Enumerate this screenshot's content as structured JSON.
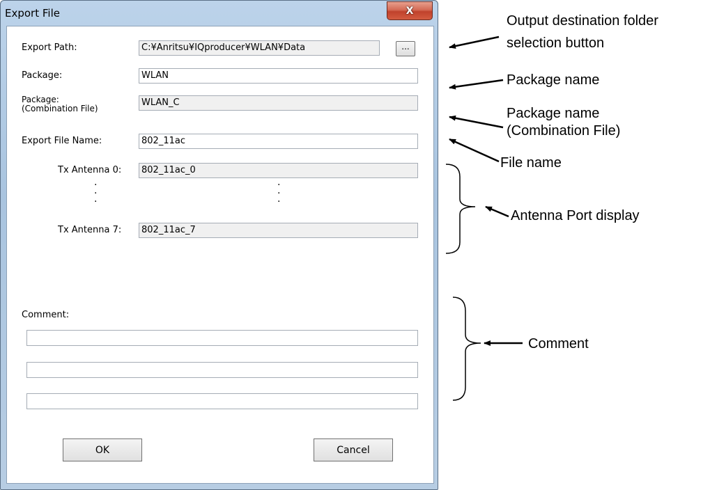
{
  "window": {
    "title": "Export File",
    "close_glyph": "X"
  },
  "form": {
    "export_path_label": "Export Path:",
    "export_path_value": "C:¥Anritsu¥IQproducer¥WLAN¥Data",
    "browse_label": "...",
    "package_label": "Package:",
    "package_value": "WLAN",
    "combo_label_line1": "Package:",
    "combo_label_line2": "(Combination File)",
    "combo_value": "WLAN_C",
    "file_name_label": "Export File Name:",
    "file_name_value": "802_11ac",
    "tx0_label": "Tx Antenna 0:",
    "tx0_value": "802_11ac_0",
    "tx7_label": "Tx Antenna 7:",
    "tx7_value": "802_11ac_7",
    "comment_label": "Comment:",
    "comments": [
      "",
      "",
      ""
    ]
  },
  "buttons": {
    "ok": "OK",
    "cancel": "Cancel"
  },
  "annotations": {
    "browse_line1": "Output destination folder",
    "browse_line2": "selection button",
    "package_name": "Package name",
    "combo_line1": "Package name",
    "combo_line2": "(Combination File)",
    "file_name": "File name",
    "antenna": "Antenna Port display",
    "comment": "Comment"
  },
  "icons": {
    "close": "close-icon",
    "arrow": "arrow-icon",
    "brace": "right-brace"
  }
}
